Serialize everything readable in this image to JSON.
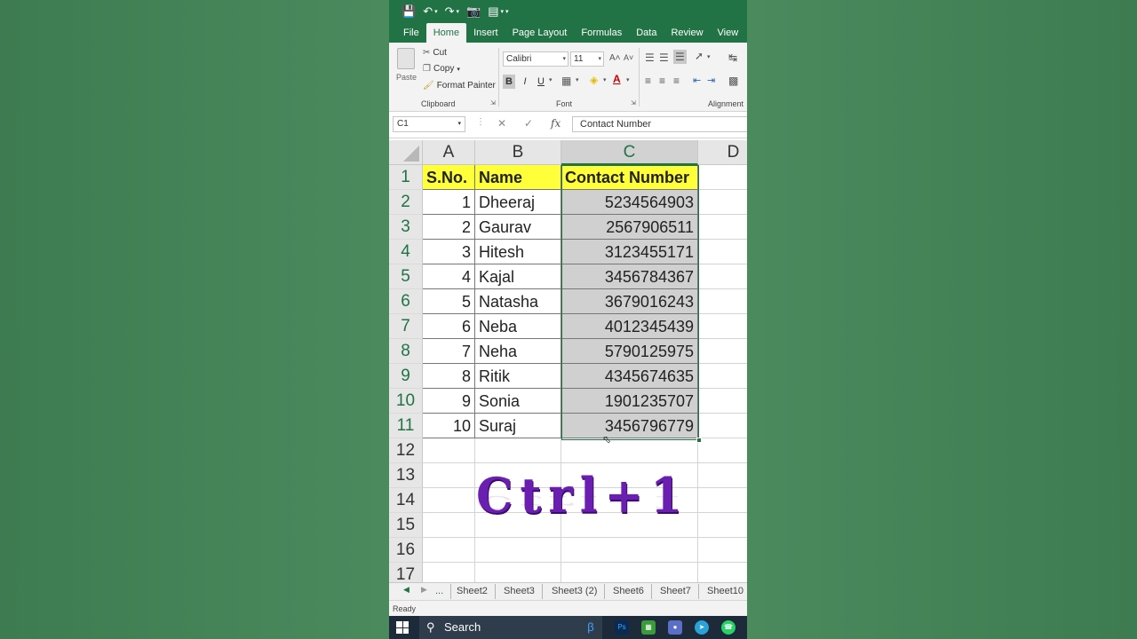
{
  "ribbon_tabs": [
    "File",
    "Home",
    "Insert",
    "Page Layout",
    "Formulas",
    "Data",
    "Review",
    "View"
  ],
  "clipboard": {
    "paste": "Paste",
    "cut": "Cut",
    "copy": "Copy",
    "format_painter": "Format Painter",
    "label": "Clipboard"
  },
  "font": {
    "name": "Calibri",
    "size": "11",
    "label": "Font",
    "bold": "B",
    "italic": "I",
    "underline": "U"
  },
  "alignment": {
    "label": "Alignment"
  },
  "formula_bar": {
    "name_box": "C1",
    "formula": "Contact Number",
    "fx": "fx"
  },
  "columns": [
    "A",
    "B",
    "C",
    "D"
  ],
  "rows": [
    "1",
    "2",
    "3",
    "4",
    "5",
    "6",
    "7",
    "8",
    "9",
    "10",
    "11",
    "12",
    "13",
    "14",
    "15",
    "16",
    "17"
  ],
  "table": {
    "headers": [
      "S.No.",
      "Name",
      "Contact Number"
    ],
    "rows": [
      [
        "1",
        "Dheeraj",
        "5234564903"
      ],
      [
        "2",
        "Gaurav",
        "2567906511"
      ],
      [
        "3",
        "Hitesh",
        "3123455171"
      ],
      [
        "4",
        "Kajal",
        "3456784367"
      ],
      [
        "5",
        "Natasha",
        "3679016243"
      ],
      [
        "6",
        "Neba",
        "4012345439"
      ],
      [
        "7",
        "Neha",
        "5790125975"
      ],
      [
        "8",
        "Ritik",
        "4345674635"
      ],
      [
        "9",
        "Sonia",
        "1901235707"
      ],
      [
        "10",
        "Suraj",
        "3456796779"
      ]
    ]
  },
  "overlay_text": "Ctrl+1",
  "sheet_tabs": [
    "...",
    "Sheet2",
    "Sheet3",
    "Sheet3 (2)",
    "Sheet6",
    "Sheet7",
    "Sheet10"
  ],
  "status": "Ready",
  "taskbar": {
    "search": "Search"
  },
  "colors": {
    "excel_green": "#217346",
    "header_fill": "#ffff3a",
    "overlay_purple": "#6a1fb0"
  }
}
